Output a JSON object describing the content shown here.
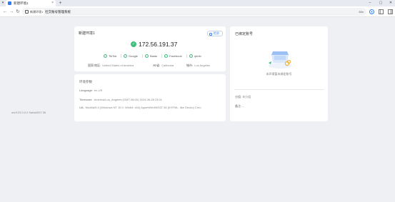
{
  "browser": {
    "tab_title": "新建环境1",
    "tab_close": "×",
    "new_tab": "+",
    "tab_nav": "▾",
    "controls": {
      "minimize": "–",
      "maximize": "▢",
      "close": "✕"
    },
    "nav": {
      "back": "←",
      "forward": "→",
      "reload": "↻"
    },
    "site_chip": "新建环境1",
    "url": "社交账号管理系统",
    "zoom": "60x"
  },
  "env_card": {
    "title": "新建环境1",
    "detect_button": "检测",
    "ip": "172.56.191.37",
    "services": [
      "TikTok",
      "Google",
      "Baidu",
      "Facebook",
      "ipInfo"
    ],
    "geo": [
      {
        "label": "国家/地区:",
        "value": "United States of America"
      },
      {
        "label": "州/省:",
        "value": "California"
      },
      {
        "label": "城市:",
        "value": "Los Angeles"
      }
    ]
  },
  "params_card": {
    "title": "环境参数",
    "language_label": "Language:",
    "language_value": "en-US",
    "timezone_label": "Timezone:",
    "timezone_value": "America/Los_Angeles (GMT-08:00) 2024-06-28 23:01",
    "ua_label": "UA:",
    "ua_value": "Mozilla/5.0 (Windows NT 10.0; Win64; x64) AppleWebKit/537.36 (KHTML, like Gecko) Chro",
    "ua_value_cont": "me/123.0.0.0 Safari/537.36"
  },
  "bind_card": {
    "title": "已绑定账号",
    "empty_text": "本环境暂未绑定账号",
    "group_label": "分组:",
    "group_value": "未分组",
    "note_label": "备注:",
    "note_value": "--"
  },
  "colors": {
    "accent": "#2f7df6",
    "success": "#3fbf7f",
    "page_bg": "#eef0f4"
  }
}
